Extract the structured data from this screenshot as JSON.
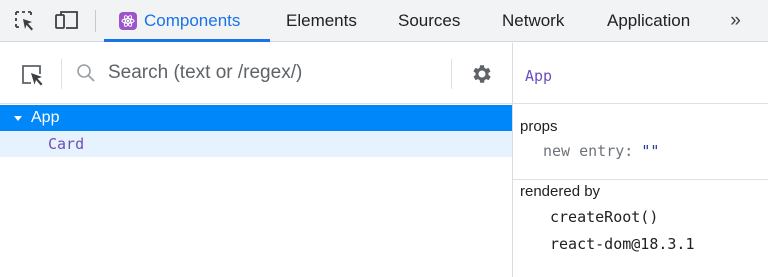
{
  "tabs": [
    {
      "label": "Components",
      "icon": "react-icon",
      "active": true
    },
    {
      "label": "Elements",
      "active": false
    },
    {
      "label": "Sources",
      "active": false
    },
    {
      "label": "Network",
      "active": false
    },
    {
      "label": "Application",
      "active": false
    }
  ],
  "more_tabs": "»",
  "search": {
    "placeholder": "Search (text or /regex/)",
    "value": ""
  },
  "tree": [
    {
      "label": "App",
      "selected": true,
      "expanded": true
    },
    {
      "label": "Card",
      "selected": false
    }
  ],
  "inspector": {
    "title": "App",
    "props_title": "props",
    "props": [
      {
        "key": "new entry",
        "value": "\"\""
      }
    ],
    "rendered_by_title": "rendered by",
    "rendered_by": [
      "createRoot()",
      "react-dom@18.3.1"
    ]
  },
  "colors": {
    "accent": "#1a73e8",
    "selected_row": "#0088fa",
    "hover_row": "#e6f2fe",
    "component_name": "#6b4fbb",
    "react_badge": "#9c56c9"
  }
}
